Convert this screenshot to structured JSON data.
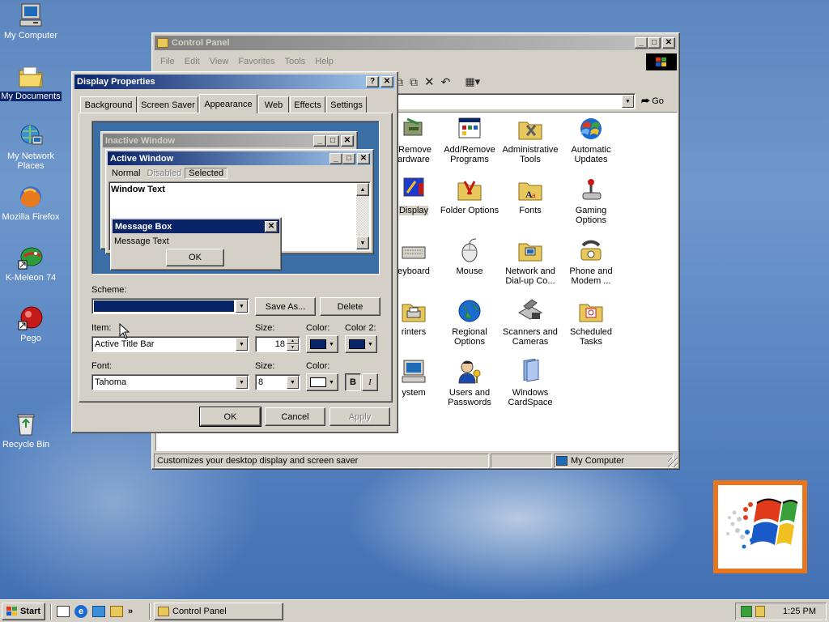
{
  "desktop": {
    "icons": [
      {
        "label": "My Computer"
      },
      {
        "label": "My Documents"
      },
      {
        "label": "My Network Places"
      },
      {
        "label": "Mozilla Firefox"
      },
      {
        "label": "K-Meleon 74"
      },
      {
        "label": "Pego"
      },
      {
        "label": "Recycle Bin"
      }
    ]
  },
  "control_panel": {
    "title": "Control Panel",
    "menu": [
      "File",
      "Edit",
      "View",
      "Favorites",
      "Tools",
      "Help"
    ],
    "go_label": "Go",
    "items": [
      {
        "label": "/Remove ardware"
      },
      {
        "label": "Add/Remove Programs"
      },
      {
        "label": "Administrative Tools"
      },
      {
        "label": "Automatic Updates"
      },
      {
        "label": "Display"
      },
      {
        "label": "Folder Options"
      },
      {
        "label": "Fonts"
      },
      {
        "label": "Gaming Options"
      },
      {
        "label": "eyboard"
      },
      {
        "label": "Mouse"
      },
      {
        "label": "Network and Dial-up Co..."
      },
      {
        "label": "Phone and Modem ..."
      },
      {
        "label": "rinters"
      },
      {
        "label": "Regional Options"
      },
      {
        "label": "Scanners and Cameras"
      },
      {
        "label": "Scheduled Tasks"
      },
      {
        "label": "ystem"
      },
      {
        "label": "Users and Passwords"
      },
      {
        "label": "Windows CardSpace"
      }
    ],
    "status_text": "Customizes your desktop display and screen saver",
    "status_zone": "My Computer"
  },
  "display_properties": {
    "title": "Display Properties",
    "tabs": [
      "Background",
      "Screen Saver",
      "Appearance",
      "Web",
      "Effects",
      "Settings"
    ],
    "active_tab": "Appearance",
    "preview": {
      "inactive_title": "Inactive Window",
      "active_title": "Active Window",
      "menu_normal": "Normal",
      "menu_disabled": "Disabled",
      "menu_selected": "Selected",
      "window_text": "Window Text",
      "message_title": "Message Box",
      "message_text": "Message Text",
      "ok": "OK"
    },
    "scheme_label": "Scheme:",
    "save_as": "Save As...",
    "delete": "Delete",
    "item_label": "Item:",
    "item_value": "Active Title Bar",
    "size_label": "Size:",
    "size_value": "18",
    "color_label": "Color:",
    "color2_label": "Color 2:",
    "font_label": "Font:",
    "font_value": "Tahoma",
    "font_size_label": "Size:",
    "font_size_value": "8",
    "font_color_label": "Color:",
    "bold": "B",
    "italic": "I",
    "ok": "OK",
    "cancel": "Cancel",
    "apply": "Apply"
  },
  "taskbar": {
    "start": "Start",
    "task": "Control Panel",
    "clock": "1:25 PM"
  },
  "colors": {
    "title_active": "#0a246a",
    "title_gradient_end": "#a6caf0",
    "face": "#d4d0c8"
  }
}
